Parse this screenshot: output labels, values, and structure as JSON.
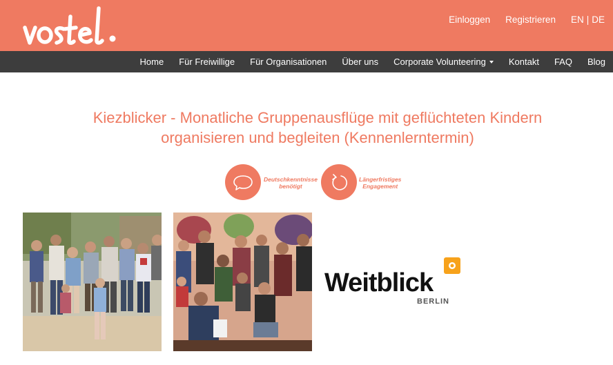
{
  "brand": {
    "name": "vostel.",
    "accent_color": "#ef7a61",
    "nav_bg": "#3d3d3d"
  },
  "top_links": {
    "login": "Einloggen",
    "register": "Registrieren",
    "lang_en": "EN",
    "lang_sep": "|",
    "lang_de": "DE"
  },
  "nav": {
    "home": "Home",
    "volunteers": "Für Freiwillige",
    "organisations": "Für Organisationen",
    "about": "Über uns",
    "corporate": "Corporate Volunteering",
    "contact": "Kontakt",
    "faq": "FAQ",
    "blog": "Blog"
  },
  "page": {
    "title_line1": "Kiezblicker - Monatliche Gruppenausflüge mit geflüchteten Kindern",
    "title_line2": "organisieren und begleiten (Kennenlerntermin)"
  },
  "badges": [
    {
      "icon": "speech-bubble-icon",
      "line1": "Deutschkenntnisse",
      "line2": "benötigt"
    },
    {
      "icon": "refresh-icon",
      "line1": "Längerfristiges",
      "line2": "Engagement"
    }
  ],
  "organisation_logo": {
    "name": "Weitblick",
    "sub": "BERLIN",
    "puzzle_color": "#f7a21b"
  }
}
